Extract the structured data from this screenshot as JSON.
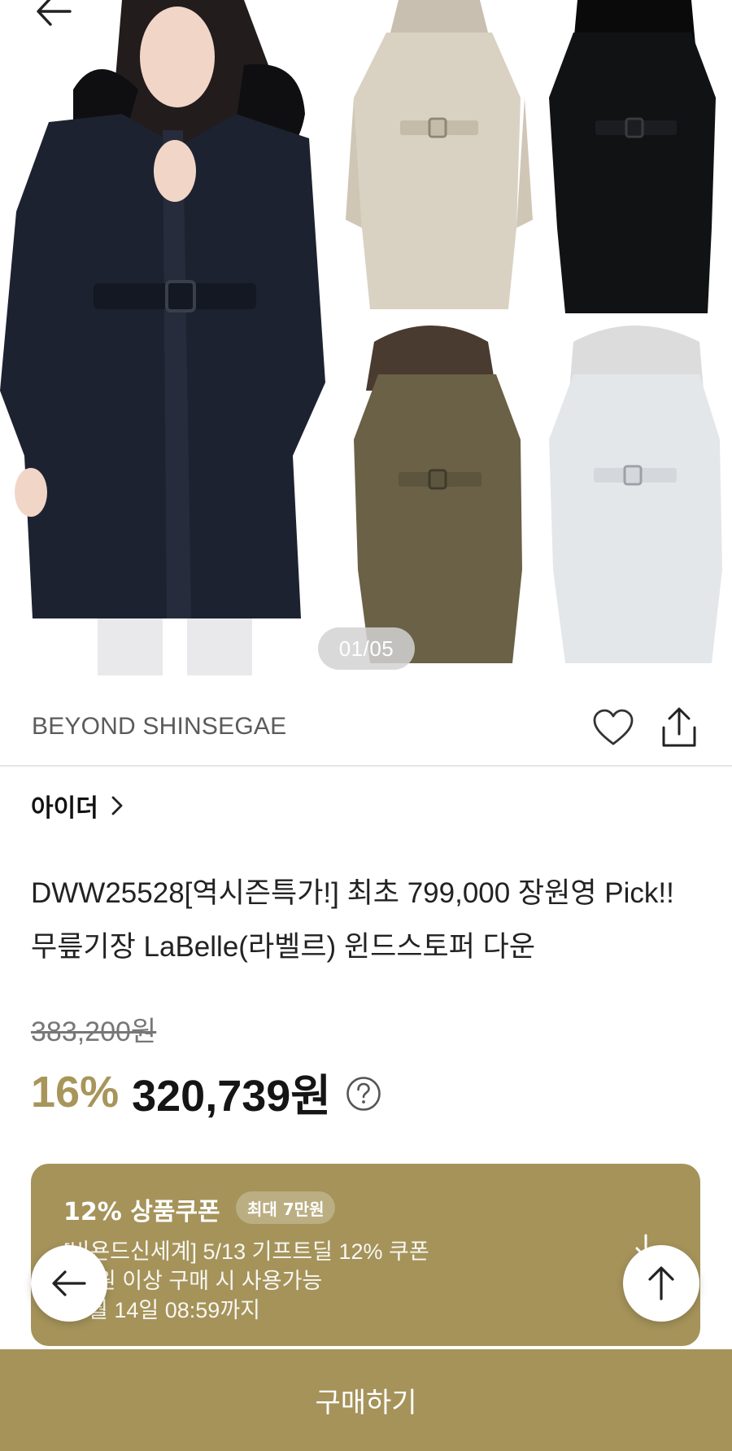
{
  "gallery": {
    "pager": "01/05",
    "coat_colors": [
      "#1d2230",
      "#d9d1c2",
      "#111214",
      "#6a6146",
      "#e4e7ea"
    ]
  },
  "brand": {
    "name": "BEYOND SHINSEGAE"
  },
  "store": {
    "name": "아이더"
  },
  "product": {
    "title": "DWW25528[역시즌특가!] 최초 799,000 장원영 Pick!! 무릎기장 LaBelle(라벨르) 윈드스토퍼 다운"
  },
  "price": {
    "original": "383,200원",
    "discount": "16%",
    "sale": "320,739원"
  },
  "coupon": {
    "title": "12% 상품쿠폰",
    "badge": "최대 7만원",
    "line1": "[비욘드신세계] 5/13 기프트딜 12% 쿠폰",
    "line2": "1만원 이상 구매 시 사용가능",
    "line3": "05월 14일 08:59까지"
  },
  "actions": {
    "buy_label": "구매하기"
  },
  "colors": {
    "accent": "#a5935a",
    "discount_text": "#a8955a"
  }
}
